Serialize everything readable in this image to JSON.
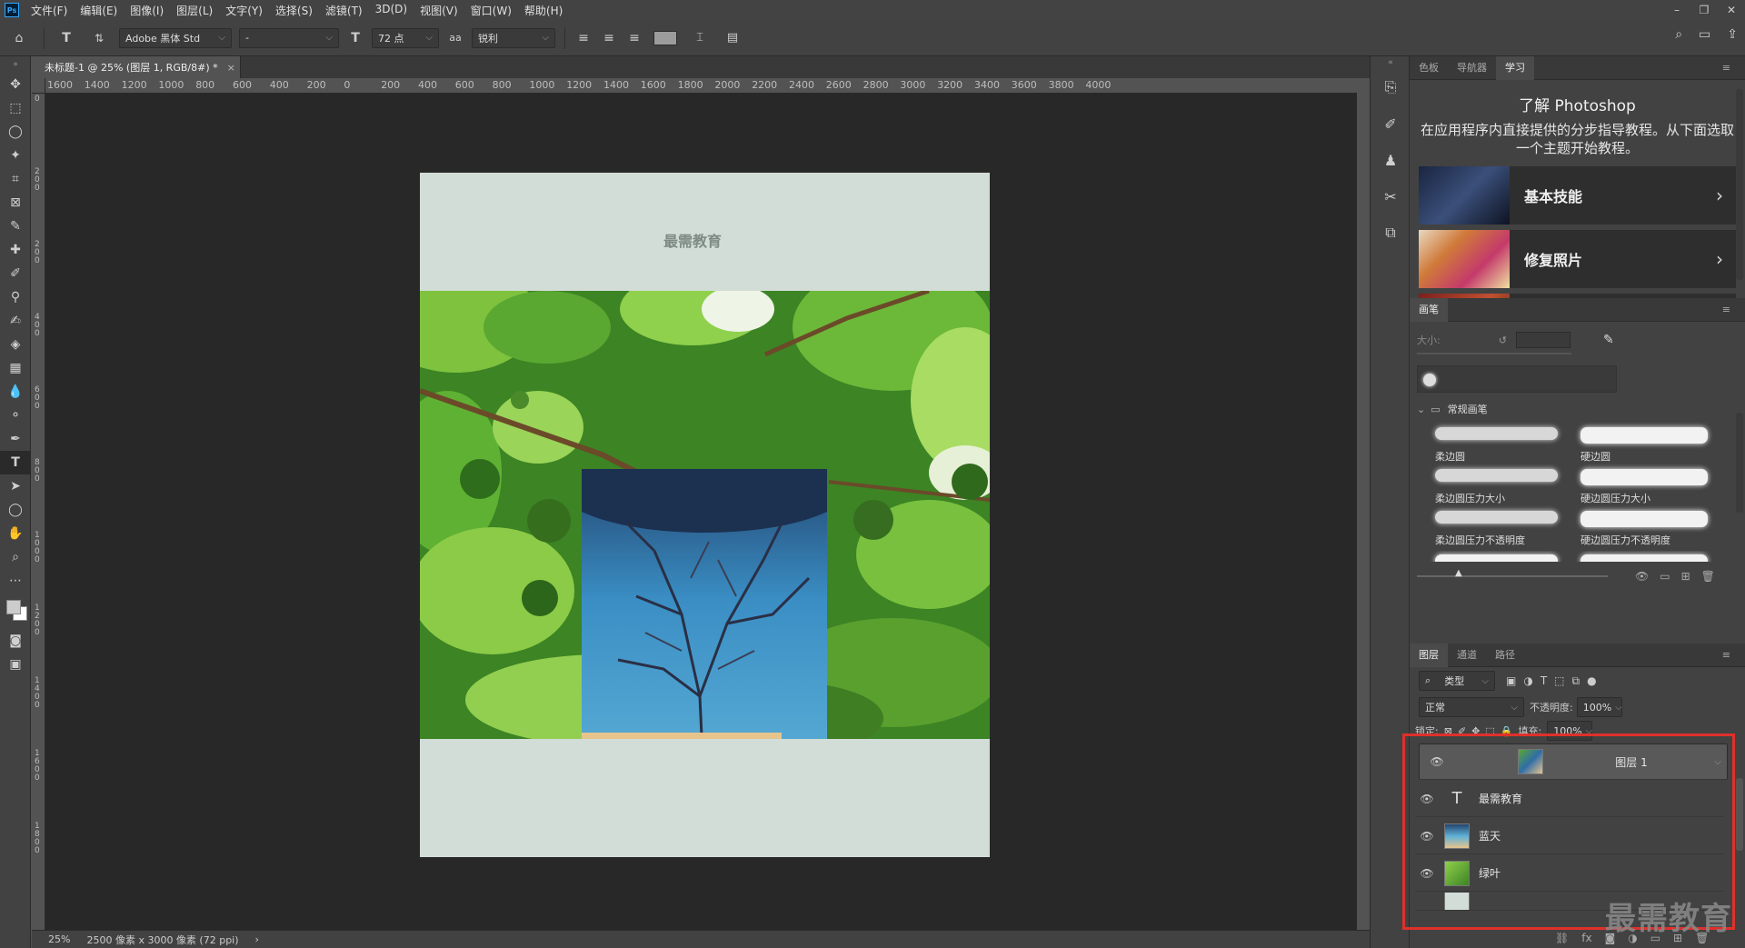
{
  "app": {
    "logo": "Ps"
  },
  "menubar": {
    "items": [
      "文件(F)",
      "编辑(E)",
      "图像(I)",
      "图层(L)",
      "文字(Y)",
      "选择(S)",
      "滤镜(T)",
      "3D(D)",
      "视图(V)",
      "窗口(W)",
      "帮助(H)"
    ],
    "window_controls": [
      "–",
      "❐",
      "✕"
    ]
  },
  "options_bar": {
    "font_family": "Adobe 黑体 Std",
    "font_style": "-",
    "font_size": "72 点",
    "antialias_icon": "aa",
    "antialias": "锐利"
  },
  "document": {
    "tab_title": "未标题-1 @ 25% (图层 1, RGB/8#) *",
    "close": "×",
    "canvas_title_text": "最需教育"
  },
  "ruler": {
    "h_ticks": [
      "1600",
      "1400",
      "1200",
      "1000",
      "800",
      "600",
      "400",
      "200",
      "0",
      "200",
      "400",
      "600",
      "800",
      "1000",
      "1200",
      "1400",
      "1600",
      "1800",
      "2000",
      "2200",
      "2400",
      "2600",
      "2800",
      "3000",
      "3200",
      "3400",
      "3600",
      "3800",
      "4000"
    ],
    "v_ticks": [
      "0",
      "200",
      "200",
      "400",
      "600",
      "800",
      "1000",
      "1200",
      "1400",
      "1600",
      "1800"
    ]
  },
  "status_bar": {
    "zoom": "25%",
    "doc_info": "2500 像素 x 3000 像素 (72 ppi)",
    "arrow": "›"
  },
  "learn_panel": {
    "tabs": [
      "色板",
      "导航器",
      "学习"
    ],
    "active_tab": "学习",
    "title": "了解 Photoshop",
    "description": "在应用程序内直接提供的分步指导教程。从下面选取一个主题开始教程。",
    "cards": [
      {
        "label": "基本技能"
      },
      {
        "label": "修复照片"
      }
    ]
  },
  "brush_panel": {
    "tab": "画笔",
    "size_label": "大小:",
    "group_name": "常规画笔",
    "brushes": [
      "柔边圆",
      "硬边圆",
      "柔边圆压力大小",
      "硬边圆压力大小",
      "柔边圆压力不透明度",
      "硬边圆压力不透明度"
    ]
  },
  "layers_panel": {
    "tabs": [
      "图层",
      "通道",
      "路径"
    ],
    "active_tab": "图层",
    "filter_label": "类型",
    "blend_mode": "正常",
    "opacity_label": "不透明度:",
    "opacity_value": "100%",
    "lock_label": "锁定:",
    "fill_label": "填充:",
    "fill_value": "100%",
    "layers": [
      {
        "name": "图层 1",
        "selected": true,
        "type": "image"
      },
      {
        "name": "最需教育",
        "selected": false,
        "type": "text"
      },
      {
        "name": "蓝天",
        "selected": false,
        "type": "image"
      },
      {
        "name": "绿叶",
        "selected": false,
        "type": "image"
      }
    ]
  },
  "watermark": "最需教育",
  "colors": {
    "highlight": "#e0302a",
    "canvas_bg": "#d3ddd7"
  }
}
